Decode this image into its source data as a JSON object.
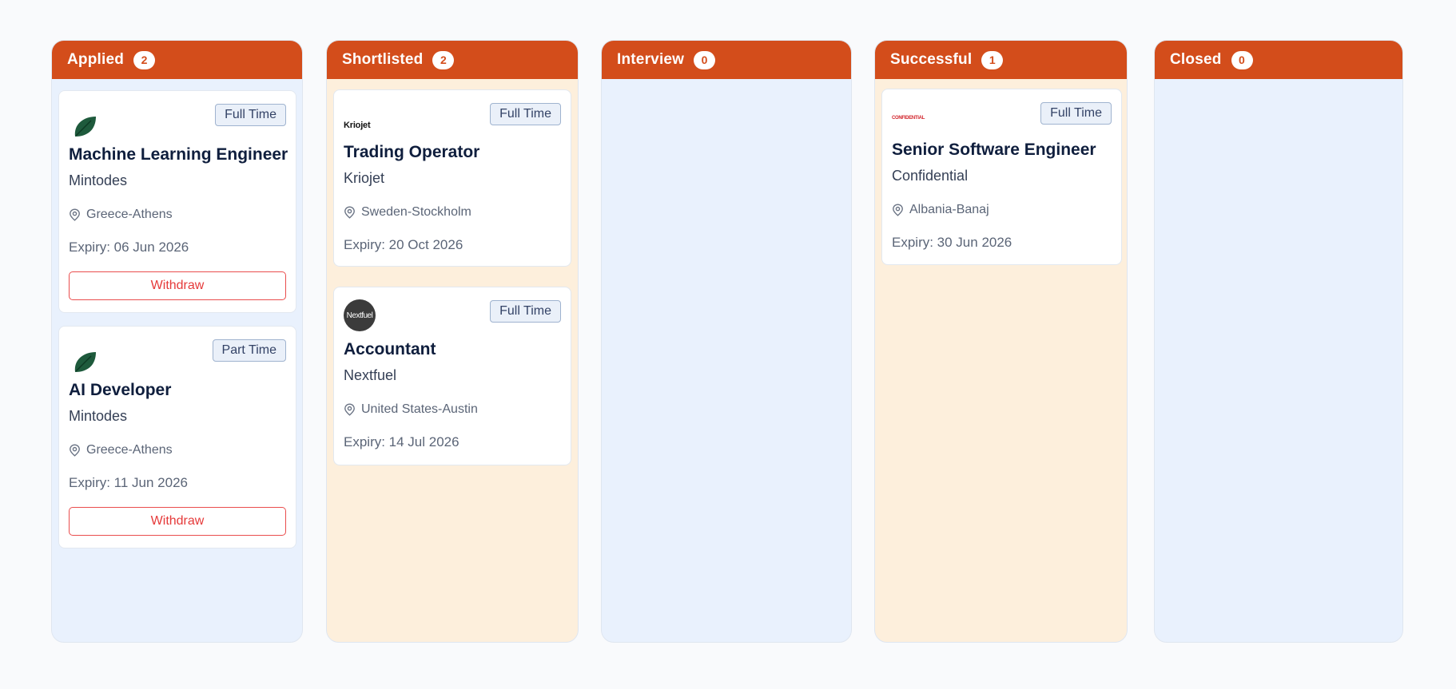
{
  "columns": [
    {
      "title": "Applied",
      "count": "2",
      "cards": [
        {
          "logo": "green-leaf-logo",
          "job_type": "Full Time",
          "title": "Machine Learning Engineer",
          "company": "Mintodes",
          "location": "Greece-Athens",
          "expiry": "Expiry: 06 Jun 2026",
          "action": "Withdraw"
        },
        {
          "logo": "green-leaf-logo",
          "job_type": "Part Time",
          "title": "AI Developer",
          "company": "Mintodes",
          "location": "Greece-Athens",
          "expiry": "Expiry: 11 Jun 2026",
          "action": "Withdraw"
        }
      ]
    },
    {
      "title": "Shortlisted",
      "count": "2",
      "cards": [
        {
          "logo_text": "Kriojet",
          "job_type": "Full Time",
          "title": "Trading Operator",
          "company": "Kriojet",
          "location": "Sweden-Stockholm",
          "expiry": "Expiry: 20 Oct 2026"
        },
        {
          "logo_text": "Nextfuel",
          "job_type": "Full Time",
          "title": "Accountant",
          "company": "Nextfuel",
          "location": "United States-Austin",
          "expiry": "Expiry: 14 Jul 2026"
        }
      ]
    },
    {
      "title": "Interview",
      "count": "0",
      "cards": []
    },
    {
      "title": "Successful",
      "count": "1",
      "cards": [
        {
          "logo_text": "CONFIDENTIAL",
          "job_type": "Full Time",
          "title": "Senior Software Engineer",
          "company": "Confidential",
          "location": "Albania-Banaj",
          "expiry": "Expiry: 30 Jun 2026"
        }
      ]
    },
    {
      "title": "Closed",
      "count": "0",
      "cards": []
    }
  ],
  "colors": {
    "header": "#d34d1b",
    "column_blue": "#e9f1fd",
    "column_peach": "#fdefdc",
    "withdraw": "#e53939"
  },
  "icons": {
    "location": "map-pin-icon"
  }
}
